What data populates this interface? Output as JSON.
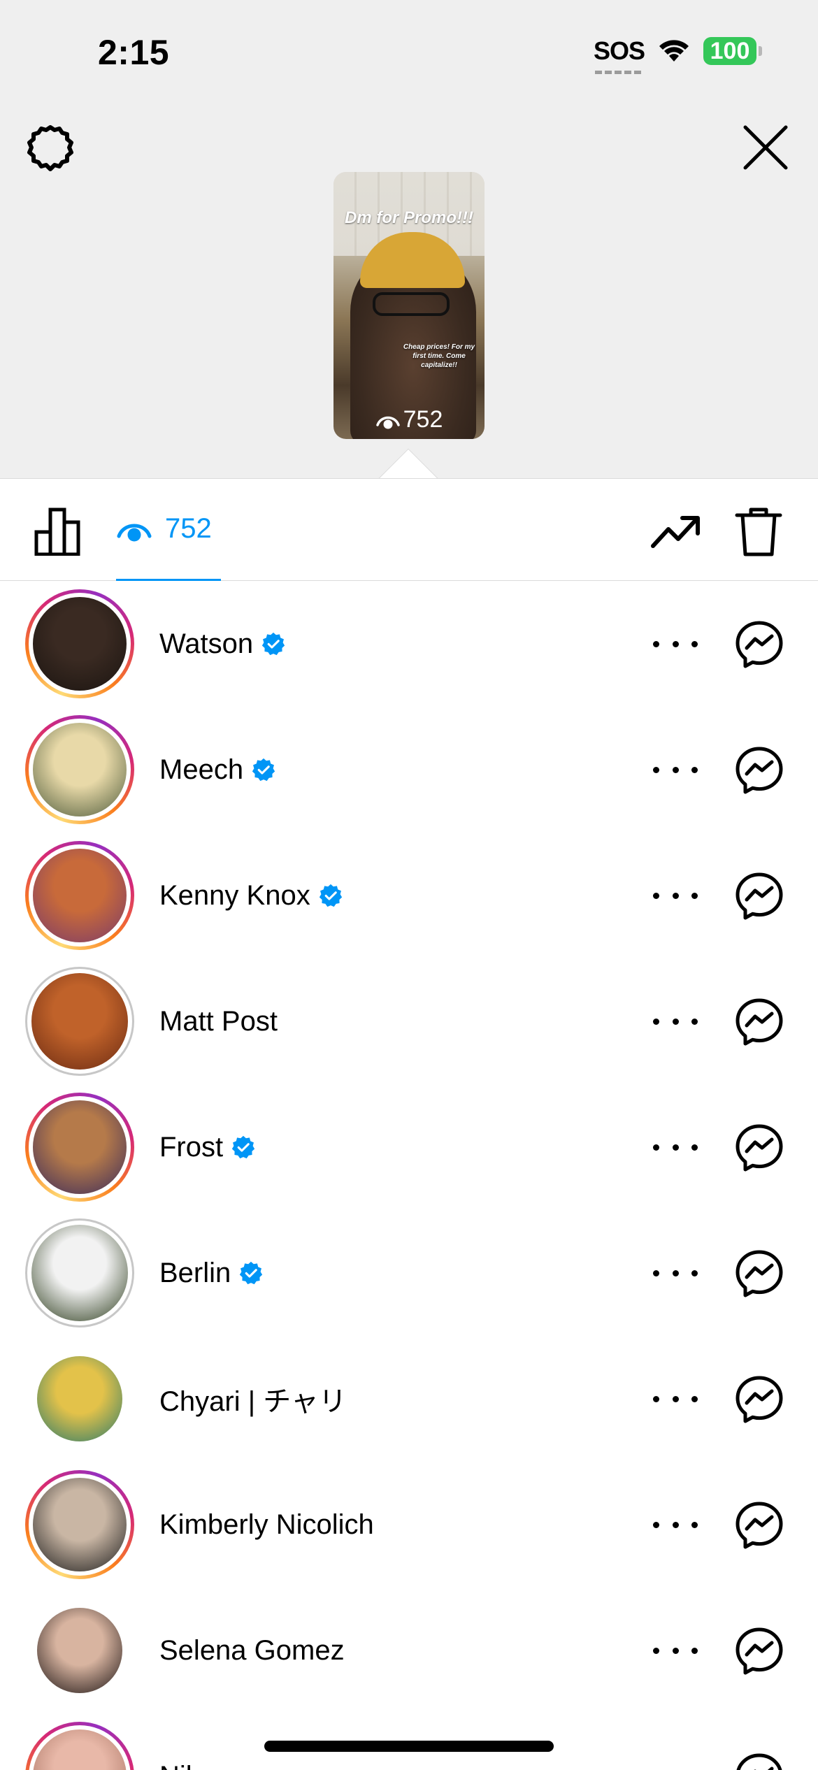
{
  "status_bar": {
    "time": "2:15",
    "sos": "SOS",
    "battery": "100"
  },
  "story": {
    "title": "Dm for Promo!!!",
    "caption": "Cheap prices! For my first time. Come capitalize!!",
    "view_count": "752"
  },
  "tabs": {
    "viewers_count": "752",
    "active_color": "#0095f6"
  },
  "viewers": [
    {
      "name": "Watson",
      "verified": true,
      "ring": "story",
      "avatar_colors": [
        "#3a2a22",
        "#1a1410"
      ]
    },
    {
      "name": "Meech",
      "verified": true,
      "ring": "story",
      "avatar_colors": [
        "#e8d9a8",
        "#4d5a3a"
      ]
    },
    {
      "name": "Kenny Knox",
      "verified": true,
      "ring": "story",
      "avatar_colors": [
        "#c86a3a",
        "#7a3a6a"
      ]
    },
    {
      "name": "Matt Post",
      "verified": false,
      "ring": "seen",
      "avatar_colors": [
        "#c0622a",
        "#6a2a12"
      ]
    },
    {
      "name": "Frost",
      "verified": true,
      "ring": "story",
      "avatar_colors": [
        "#b57a4a",
        "#3a2a5a"
      ]
    },
    {
      "name": "Berlin",
      "verified": true,
      "ring": "seen",
      "avatar_colors": [
        "#f2f2f2",
        "#2a3a1a"
      ]
    },
    {
      "name": "Chyari | チャリ",
      "verified": false,
      "ring": "none",
      "avatar_colors": [
        "#e3c24a",
        "#2a7a6a"
      ]
    },
    {
      "name": "Kimberly Nicolich",
      "verified": false,
      "ring": "story",
      "avatar_colors": [
        "#c9b6a4",
        "#1a1a1a"
      ]
    },
    {
      "name": "Selena Gomez",
      "verified": false,
      "ring": "none",
      "avatar_colors": [
        "#d8b4a0",
        "#1a1212"
      ]
    },
    {
      "name": "Niko",
      "verified": false,
      "ring": "story",
      "avatar_colors": [
        "#e8b8a8",
        "#a06a5a"
      ]
    }
  ],
  "icons": {
    "settings": "gear-icon",
    "close": "close-icon",
    "insights": "bar-chart-icon",
    "views": "eye-icon",
    "promote": "trending-up-icon",
    "delete": "trash-icon",
    "more": "more-horizontal-icon",
    "message": "messenger-icon",
    "verified": "verified-badge-icon"
  }
}
